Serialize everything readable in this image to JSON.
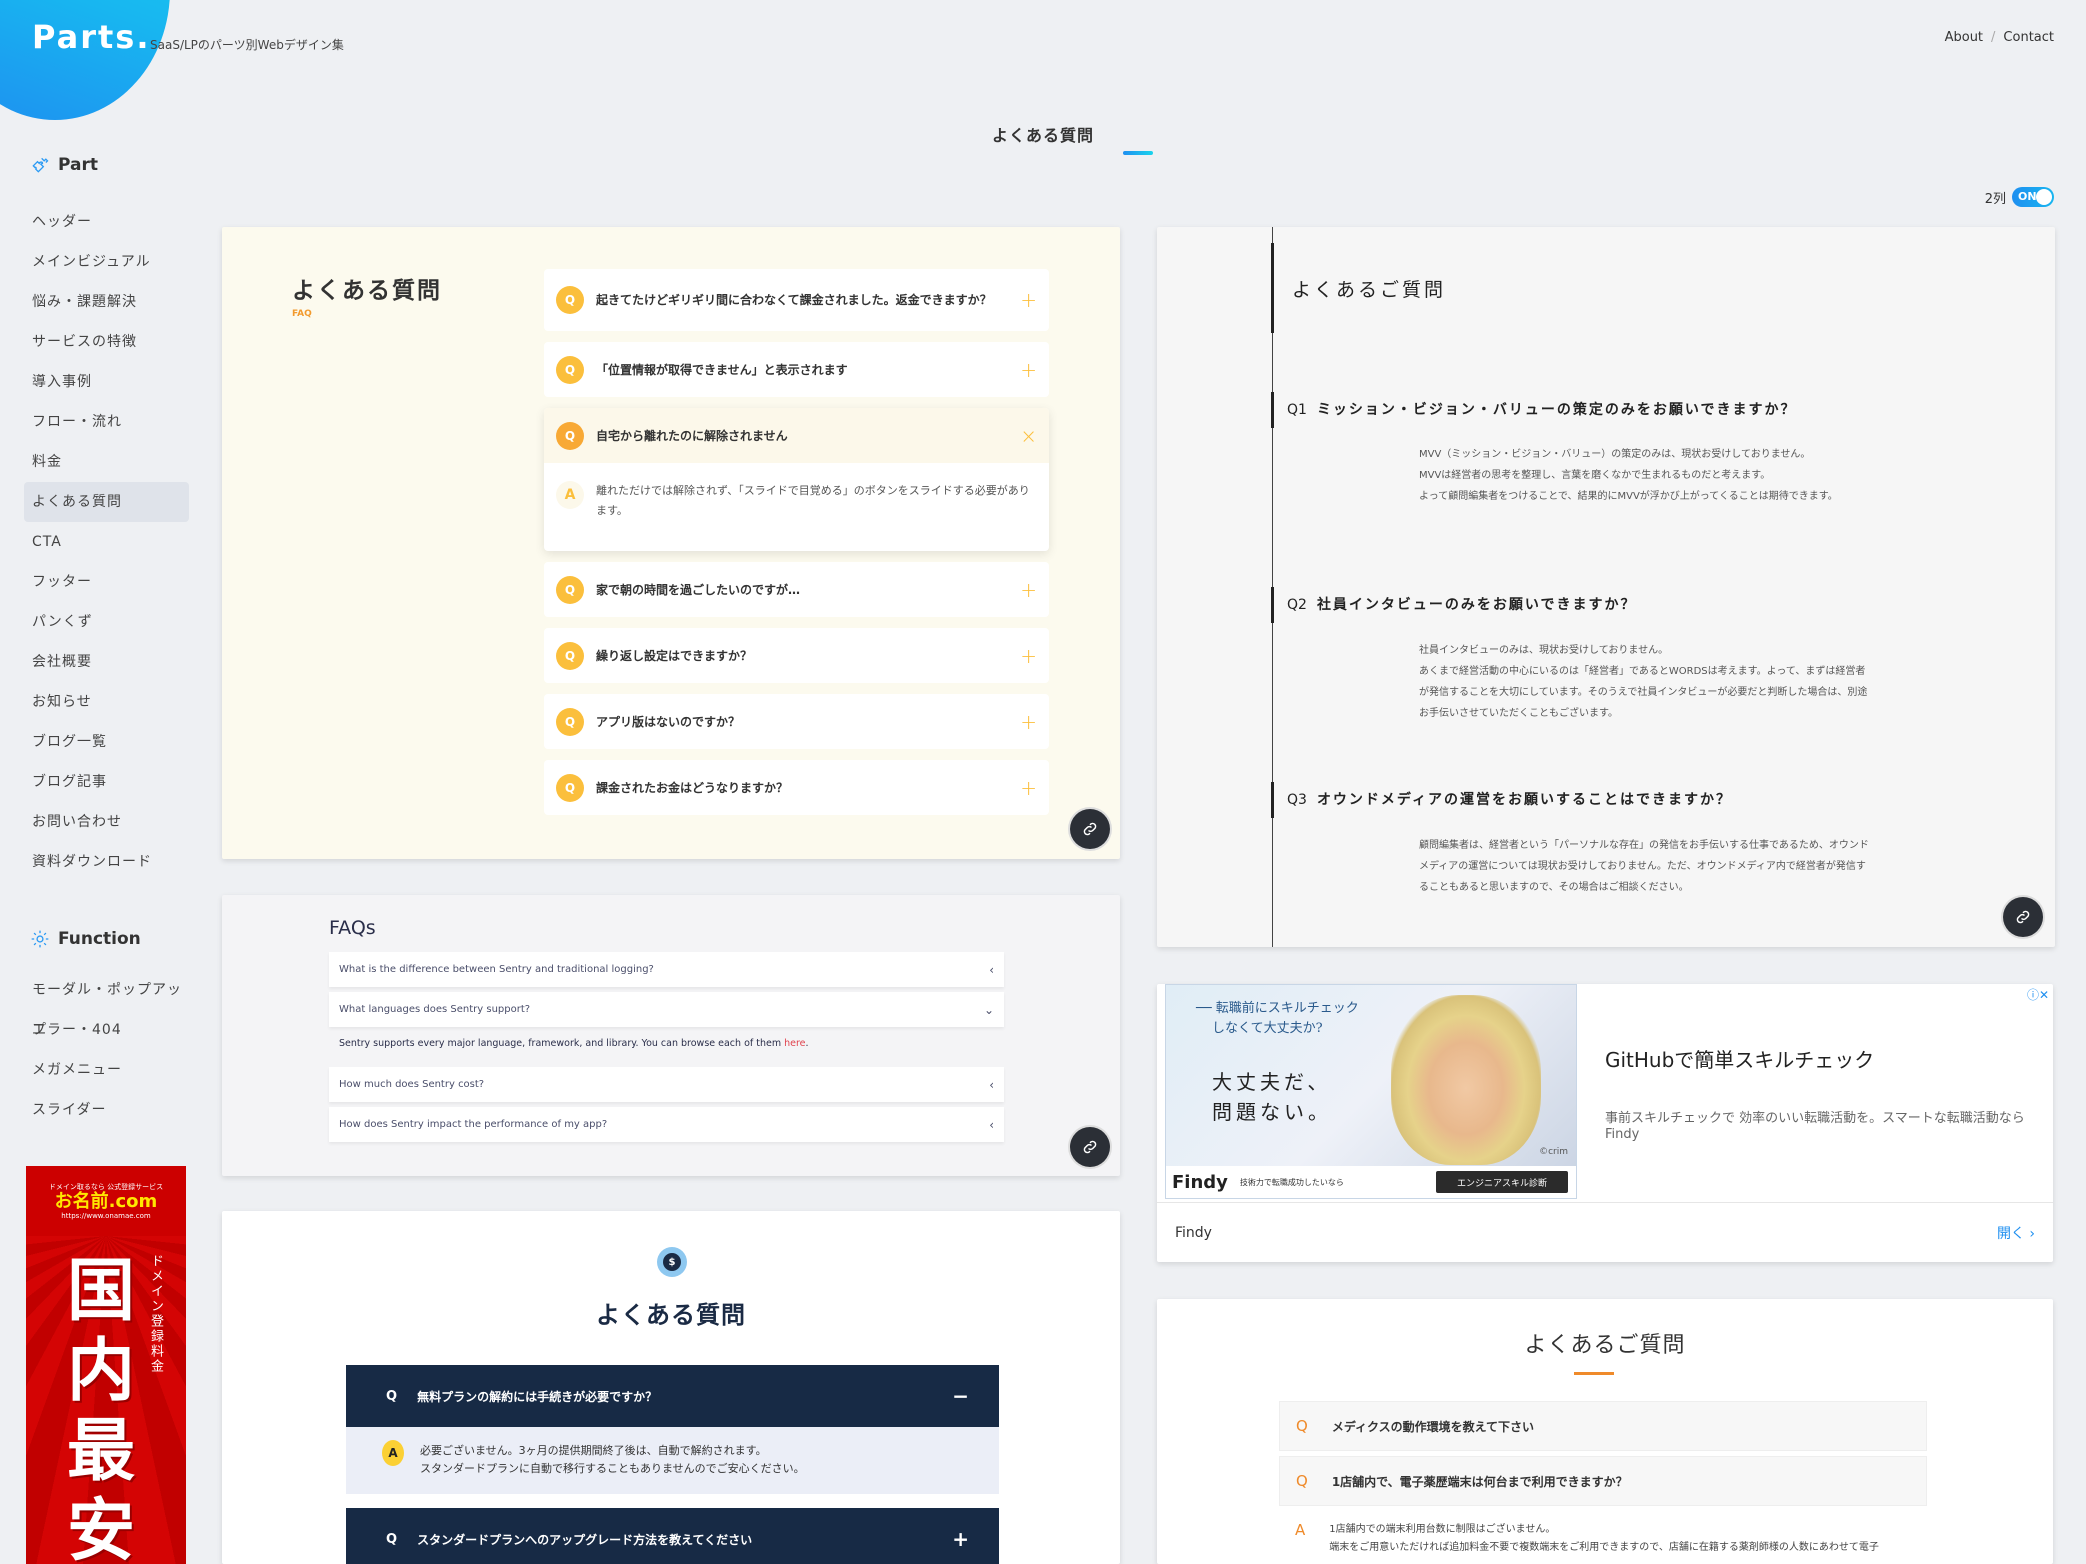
{
  "header": {
    "logo": "Parts.",
    "tagline": "SaaS/LPのパーツ別Webデザイン集",
    "nav": [
      {
        "label": "About"
      },
      {
        "label": "Contact"
      }
    ],
    "nav_separator": "/"
  },
  "page": {
    "title": "よくある質問",
    "column_toggle_label": "2列",
    "column_toggle_state": "ON",
    "accent_color": "#1e8ff0"
  },
  "sidebar": {
    "part_heading": "Part",
    "part_items": [
      {
        "label": "ヘッダー"
      },
      {
        "label": "メインビジュアル"
      },
      {
        "label": "悩み・課題解決"
      },
      {
        "label": "サービスの特徴"
      },
      {
        "label": "導入事例"
      },
      {
        "label": "フロー・流れ"
      },
      {
        "label": "料金"
      },
      {
        "label": "よくある質問",
        "active": true
      },
      {
        "label": "CTA"
      },
      {
        "label": "フッター"
      },
      {
        "label": "パンくず"
      },
      {
        "label": "会社概要"
      },
      {
        "label": "お知らせ"
      },
      {
        "label": "ブログ一覧"
      },
      {
        "label": "ブログ記事"
      },
      {
        "label": "お問い合わせ"
      },
      {
        "label": "資料ダウンロード"
      }
    ],
    "function_heading": "Function",
    "function_items": [
      {
        "label": "モーダル・ポップアップ"
      },
      {
        "label": "エラー・404"
      },
      {
        "label": "メガメニュー"
      },
      {
        "label": "スライダー"
      }
    ],
    "ad": {
      "small": "ドメイン取るなら 公式登録サービス",
      "brand": "お名前.com",
      "url": "https://www.onamae.com",
      "big": "国内最安",
      "vertical": "ドメイン登録料金"
    }
  },
  "cards": {
    "c1": {
      "title": "よくある質問",
      "subtitle": "FAQ",
      "q_badge": "Q",
      "a_badge": "A",
      "plus": "+",
      "close": "×",
      "items": [
        {
          "q": "起きてたけどギリギリ間に合わなくて課金されました。返金できますか？"
        },
        {
          "q": "「位置情報が取得できません」と表示されます"
        },
        {
          "q": "自宅から離れたのに解除されません",
          "open": true,
          "a": "離れただけでは解除されず、「スライドで目覚める」のボタンをスライドする必要があります。"
        },
        {
          "q": "家で朝の時間を過ごしたいのですが…"
        },
        {
          "q": "繰り返し設定はできますか？"
        },
        {
          "q": "アプリ版はないのですか？"
        },
        {
          "q": "課金されたお金はどうなりますか？"
        }
      ]
    },
    "c2": {
      "title": "よくあるご質問",
      "items": [
        {
          "num": "Q1",
          "q": "ミッション・ビジョン・バリューの策定のみをお願いできますか？",
          "a": [
            "MVV（ミッション・ビジョン・バリュー）の策定のみは、現状お受けしておりません。",
            "MVVは経営者の思考を整理し、言葉を磨くなかで生まれるものだと考えます。",
            "よって顧問編集者をつけることで、結果的にMVVが浮かび上がってくることは期待できます。"
          ]
        },
        {
          "num": "Q2",
          "q": "社員インタビューのみをお願いできますか？",
          "a": [
            "社員インタビューのみは、現状お受けしておりません。",
            "あくまで経営活動の中心にいるのは「経営者」であるとWORDSは考えます。よって、まずは経営者が発信することを大切にしています。そのうえで社員インタビューが必要だと判断した場合は、別途お手伝いさせていただくこともございます。"
          ]
        },
        {
          "num": "Q3",
          "q": "オウンドメディアの運営をお願いすることはできますか？",
          "a": [
            "顧問編集者は、経営者という「パーソナルな存在」の発信をお手伝いする仕事であるため、オウンドメディアの運営については現状お受けしておりません。ただ、オウンドメディア内で経営者が発信することもあると思いますので、その場合はご相談ください。"
          ]
        }
      ]
    },
    "c3": {
      "title": "FAQs",
      "items": [
        {
          "q": "What is the difference between Sentry and traditional logging?",
          "state": "collapsed"
        },
        {
          "q": "What languages does Sentry support?",
          "state": "expanded"
        },
        {
          "q": "How much does Sentry cost?",
          "state": "collapsed"
        },
        {
          "q": "How does Sentry impact the performance of my app?",
          "state": "collapsed"
        }
      ],
      "answer_text": "Sentry supports every major language, framework, and library. You can browse each of them ",
      "answer_link": "here",
      "answer_end": "."
    },
    "c4": {
      "image_line1": "── 転職前にスキルチェック",
      "image_line2": "しなくて大丈夫か?",
      "image_big1": "大丈夫だ、",
      "image_big2": "問題ない。",
      "image_credit": "©crim",
      "image_brand": "Findy",
      "image_tagline": "技術力で転職成功したいなら",
      "image_cta": "エンジニアスキル診断",
      "title": "GitHubで簡単スキルチェック",
      "description": "事前スキルチェックで 効率のいい転職活動を。スマートな転職活動ならFindy",
      "advertiser": "Findy",
      "open_label": "開く ›",
      "adchoices": "ⓘ✕"
    },
    "c5": {
      "icon": "$",
      "title": "よくある質問",
      "items": [
        {
          "q": "無料プランの解約には手続きが必要ですか？",
          "toggle": "−",
          "open": true,
          "a": [
            "必要ございません。3ヶ月の提供期間終了後は、自動で解約されます。",
            "スタンダードプランに自動で移行することもありませんのでご安心ください。"
          ]
        },
        {
          "q": "スタンダードプランへのアップグレード方法を教えてください",
          "toggle": "+"
        }
      ],
      "q_label": "Q",
      "a_label": "A"
    },
    "c6": {
      "title": "よくあるご質問",
      "items": [
        {
          "q": "メディクスの動作環境を教えて下さい"
        },
        {
          "q": "1店舗内で、電子薬歴端末は何台まで利用できますか？",
          "open": true,
          "a": [
            "1店舗内での端末利用台数に制限はございません。",
            "端末をご用意いただければ追加料金不要で複数端末をご利用できますので、店舗に在籍する薬剤師様の人数にあわせて電子"
          ]
        }
      ],
      "q_label": "Q",
      "a_label": "A"
    }
  }
}
